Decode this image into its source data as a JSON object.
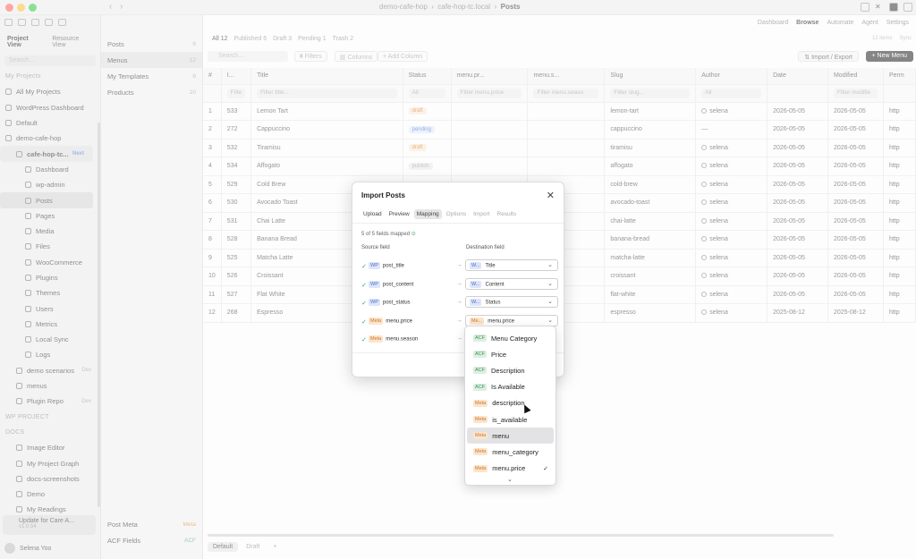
{
  "window": {
    "crumbs": [
      "demo-cafe-hop",
      "cafe-hop-tc.local",
      "Posts"
    ]
  },
  "sidebar": {
    "tabs": [
      "Project View",
      "Resource View"
    ],
    "search_placeholder": "Search...",
    "items": [
      {
        "label": "My Projects",
        "level": 0,
        "type": "section"
      },
      {
        "label": "All My Projects",
        "level": 0
      },
      {
        "label": "WordPress Dashboard",
        "level": 0
      },
      {
        "label": "Default",
        "level": 0
      },
      {
        "label": "demo-cafe-hop",
        "level": 0
      },
      {
        "label": "cafe-hop-tc...",
        "level": 1,
        "tag": "Next",
        "type": "project"
      },
      {
        "label": "Dashboard",
        "level": 2
      },
      {
        "label": "wp-admin",
        "level": 2
      },
      {
        "label": "Posts",
        "level": 2,
        "selected": true
      },
      {
        "label": "Pages",
        "level": 2
      },
      {
        "label": "Media",
        "level": 2
      },
      {
        "label": "Files",
        "level": 2
      },
      {
        "label": "WooCommerce",
        "level": 2
      },
      {
        "label": "Plugins",
        "level": 2
      },
      {
        "label": "Themes",
        "level": 2
      },
      {
        "label": "Users",
        "level": 2
      },
      {
        "label": "Metrics",
        "level": 2
      },
      {
        "label": "Local Sync",
        "level": 2
      },
      {
        "label": "Logs",
        "level": 2
      },
      {
        "label": "demo scenarios",
        "level": 1,
        "tag": "Dev"
      },
      {
        "label": "menus",
        "level": 1
      },
      {
        "label": "Plugin Repo",
        "level": 1,
        "tag": "Dev"
      },
      {
        "label": "WP PROJECT",
        "level": 0,
        "type": "section"
      },
      {
        "label": "DOCS",
        "level": 0,
        "type": "section"
      },
      {
        "label": "Image Editor",
        "level": 1
      },
      {
        "label": "My Project Graph",
        "level": 1
      },
      {
        "label": "docs-screenshots",
        "level": 1
      },
      {
        "label": "Demo",
        "level": 1
      },
      {
        "label": "My Readings",
        "level": 1
      }
    ],
    "update_card": {
      "title": "Update for Care A...",
      "version": "v1.0.54"
    },
    "user": "Selena Yoo"
  },
  "sidebar2": {
    "items": [
      {
        "label": "Posts",
        "count": "6"
      },
      {
        "label": "Menus",
        "count": "12",
        "selected": true
      },
      {
        "label": "My Templates",
        "count": "6"
      },
      {
        "label": "Products",
        "count": "20"
      }
    ],
    "bottom": [
      {
        "label": "Post Meta",
        "count": "Meta",
        "color": "orange"
      },
      {
        "label": "ACF Fields",
        "count": "ACF",
        "color": "green"
      }
    ]
  },
  "main": {
    "topnav": [
      "Dashboard",
      "Browse",
      "Automate",
      "Agent",
      "Settings"
    ],
    "topnav_active": "Browse",
    "subtabs": [
      "All 12",
      "Published 6",
      "Draft 3",
      "Pending 1",
      "Trash 2"
    ],
    "subtabs_right": [
      "12 items",
      "Sync"
    ],
    "search_placeholder": "Search...",
    "filters_label": "Filters",
    "columns_label": "Columns",
    "add_column_label": "+ Add Column",
    "import_label": "Import / Export",
    "new_label": "+ New Menu",
    "columns": [
      "#",
      "I...",
      "Title",
      "Status",
      "menu.pr...",
      "menu.s...",
      "Slug",
      "Author",
      "Date",
      "Modified",
      "Perm"
    ],
    "filters": [
      "Filte",
      "Filter title...",
      "All",
      "Filter menu.price",
      "Filter menu.seaso",
      "Filter slug...",
      "All",
      "",
      "Filter modifie",
      ""
    ],
    "rows": [
      {
        "n": "1",
        "id": "533",
        "title": "Lemon Tart",
        "status": "draft",
        "slug": "lemon-tart",
        "author": "selena",
        "date": "2026-05-05",
        "modified": "2026-05-05",
        "perm": "http"
      },
      {
        "n": "2",
        "id": "272",
        "title": "Cappuccino",
        "status": "pending",
        "slug": "cappuccino",
        "author": "—",
        "date": "2026-05-05",
        "modified": "2026-05-05",
        "perm": "http"
      },
      {
        "n": "3",
        "id": "532",
        "title": "Tiramisu",
        "status": "draft",
        "slug": "tiramisu",
        "author": "selena",
        "date": "2026-05-05",
        "modified": "2026-05-05",
        "perm": "http"
      },
      {
        "n": "4",
        "id": "534",
        "title": "Affogato",
        "status": "publish",
        "slug": "affogato",
        "author": "selena",
        "date": "2026-05-05",
        "modified": "2026-05-05",
        "perm": "http"
      },
      {
        "n": "5",
        "id": "529",
        "title": "Cold Brew",
        "status": "",
        "slug": "cold-brew",
        "author": "selena",
        "date": "2026-05-05",
        "modified": "2026-05-05",
        "perm": "http"
      },
      {
        "n": "6",
        "id": "530",
        "title": "Avocado Toast",
        "status": "",
        "slug": "avocado-toast",
        "author": "selena",
        "date": "2026-05-05",
        "modified": "2026-05-05",
        "perm": "http"
      },
      {
        "n": "7",
        "id": "531",
        "title": "Chai Latte",
        "status": "",
        "slug": "chai-latte",
        "author": "selena",
        "date": "2026-05-05",
        "modified": "2026-05-05",
        "perm": "http"
      },
      {
        "n": "8",
        "id": "528",
        "title": "Banana Bread",
        "status": "",
        "slug": "banana-bread",
        "author": "selena",
        "date": "2026-05-05",
        "modified": "2026-05-05",
        "perm": "http"
      },
      {
        "n": "9",
        "id": "525",
        "title": "Matcha Latte",
        "status": "",
        "slug": "matcha-latte",
        "author": "selena",
        "date": "2026-05-05",
        "modified": "2026-05-05",
        "perm": "http"
      },
      {
        "n": "10",
        "id": "526",
        "title": "Croissant",
        "status": "",
        "slug": "croissant",
        "author": "selena",
        "date": "2026-05-05",
        "modified": "2026-05-05",
        "perm": "http"
      },
      {
        "n": "11",
        "id": "527",
        "title": "Flat White",
        "status": "",
        "slug": "flat-white",
        "author": "selena",
        "date": "2026-05-05",
        "modified": "2026-05-05",
        "perm": "http"
      },
      {
        "n": "12",
        "id": "268",
        "title": "Espresso",
        "status": "",
        "slug": "espresso",
        "author": "selena",
        "date": "2025-08-12",
        "modified": "2025-08-12",
        "perm": "http"
      }
    ],
    "bottom_tabs": [
      "Default",
      "Draft",
      "+"
    ]
  },
  "dialog": {
    "title": "Import Posts",
    "tabs": [
      "Upload",
      "Preview",
      "Mapping",
      "Options",
      "Import",
      "Results"
    ],
    "active_tab": "Mapping",
    "mapped_text": "5 of 5 fields mapped",
    "source_header": "Source field",
    "dest_header": "Destination field",
    "mappings": [
      {
        "src_badge": "WP",
        "src": "post_title",
        "dst_badge": "W...",
        "dst": "Title"
      },
      {
        "src_badge": "WP",
        "src": "post_content",
        "dst_badge": "W...",
        "dst": "Content"
      },
      {
        "src_badge": "WP",
        "src": "post_status",
        "dst_badge": "W...",
        "dst": "Status"
      },
      {
        "src_badge": "Meta",
        "src": "menu.price",
        "dst_badge": "Me...",
        "dst": "menu.price"
      },
      {
        "src_badge": "Meta",
        "src": "menu.season",
        "dst_badge": "",
        "dst": ""
      }
    ]
  },
  "dropdown": {
    "options": [
      {
        "badge": "ACF",
        "label": "Menu Category"
      },
      {
        "badge": "ACF",
        "label": "Price"
      },
      {
        "badge": "ACF",
        "label": "Description"
      },
      {
        "badge": "ACF",
        "label": "Is Available"
      },
      {
        "badge": "Meta",
        "label": "description"
      },
      {
        "badge": "Meta",
        "label": "is_available"
      },
      {
        "badge": "Meta",
        "label": "menu",
        "highlighted": true
      },
      {
        "badge": "Meta",
        "label": "menu_category"
      },
      {
        "badge": "Meta",
        "label": "menu.price",
        "checked": true
      }
    ]
  },
  "colors": {
    "accent_dark": "#222222",
    "wp_badge": "#4a6dc9",
    "meta_badge": "#c7782d",
    "acf_badge": "#3f8f56",
    "ok_green": "#3ea35a"
  }
}
